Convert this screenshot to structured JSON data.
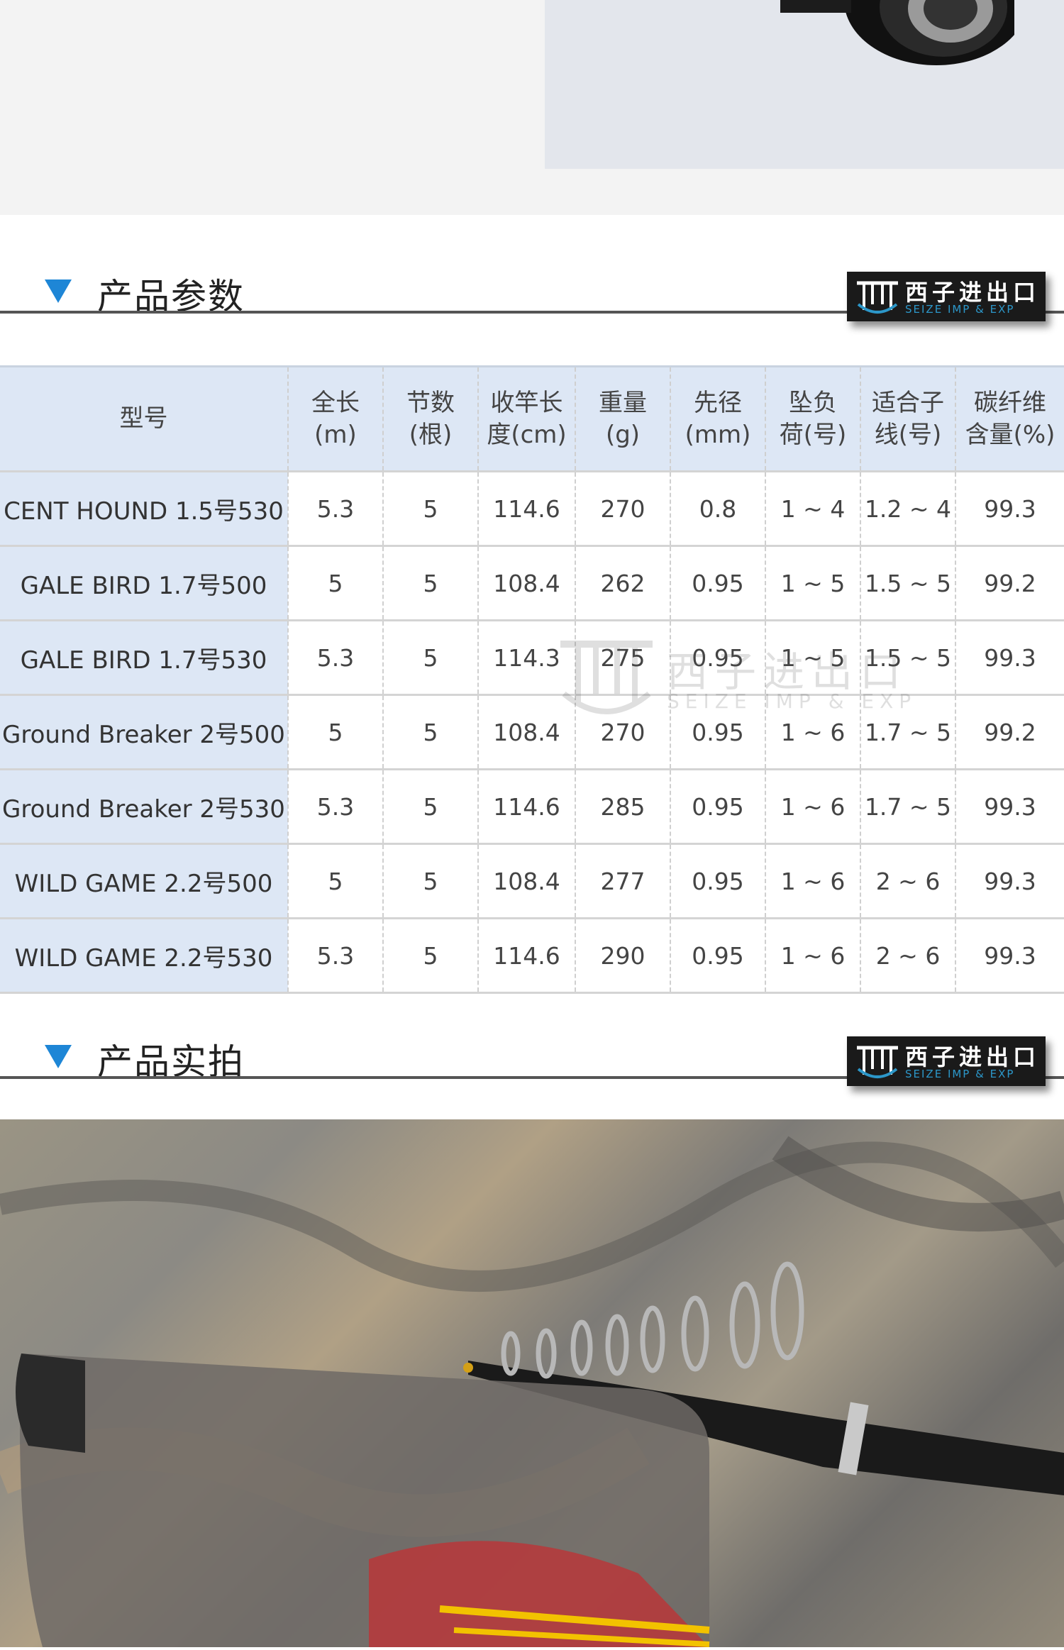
{
  "brand": {
    "cn": "西子进出口",
    "en": "SEIZE IMP & EXP"
  },
  "sections": {
    "params_title": "产品参数",
    "photos_title": "产品实拍"
  },
  "table": {
    "headers": [
      "型号",
      "全长\n(m)",
      "节数\n(根)",
      "收竿长\n度(cm)",
      "重量\n(g)",
      "先径\n(mm)",
      "坠负\n荷(号)",
      "适合子\n线(号)",
      "碳纤维\n含量(%)"
    ],
    "rows": [
      [
        "CENT HOUND 1.5号530",
        "5.3",
        "5",
        "114.6",
        "270",
        "0.8",
        "1 ~ 4",
        "1.2 ~ 4",
        "99.3"
      ],
      [
        "GALE BIRD 1.7号500",
        "5",
        "5",
        "108.4",
        "262",
        "0.95",
        "1 ~ 5",
        "1.5 ~ 5",
        "99.2"
      ],
      [
        "GALE BIRD 1.7号530",
        "5.3",
        "5",
        "114.3",
        "275",
        "0.95",
        "1 ~ 5",
        "1.5 ~ 5",
        "99.3"
      ],
      [
        "Ground Breaker 2号500",
        "5",
        "5",
        "108.4",
        "270",
        "0.95",
        "1 ~ 6",
        "1.7 ~ 5",
        "99.2"
      ],
      [
        "Ground Breaker 2号530",
        "5.3",
        "5",
        "114.6",
        "285",
        "0.95",
        "1 ~ 6",
        "1.7 ~ 5",
        "99.3"
      ],
      [
        "WILD GAME 2.2号500",
        "5",
        "5",
        "108.4",
        "277",
        "0.95",
        "1 ~ 6",
        "2 ~ 6",
        "99.3"
      ],
      [
        "WILD GAME 2.2号530",
        "5.3",
        "5",
        "114.6",
        "290",
        "0.95",
        "1 ~ 6",
        "2 ~ 6",
        "99.3"
      ]
    ]
  },
  "colors": {
    "accent_triangle": "#1e86d6",
    "header_bg": "#dde7f5",
    "badge_bg": "#1a1a1a",
    "badge_en": "#2c97c9"
  },
  "icons": {
    "section_marker": "triangle-down-icon",
    "brand_logo": "seize-logo-icon"
  }
}
